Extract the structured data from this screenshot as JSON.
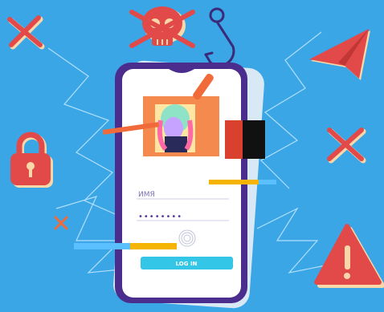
{
  "login_form": {
    "username_value": "ИМЯ",
    "password_value": "••••••••",
    "login_button_label": "LOG IN"
  },
  "colors": {
    "background": "#3aa6e6",
    "phone_frame": "#4a2d8c",
    "accent_orange": "#f06a3a",
    "accent_red": "#e24a4a",
    "accent_yellow": "#f5b400",
    "button_cyan": "#33c6e6"
  },
  "icons": [
    "skull-icon",
    "fishing-hook-icon",
    "padlock-icon",
    "warning-icon",
    "paper-plane-icon",
    "cross-icon",
    "fingerprint-icon"
  ]
}
